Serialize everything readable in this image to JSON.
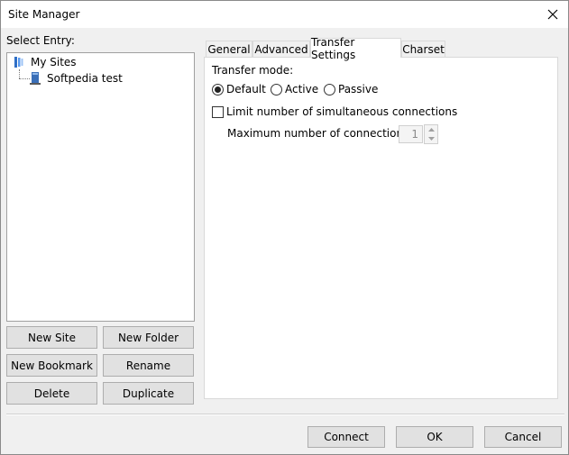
{
  "window": {
    "title": "Site Manager"
  },
  "left": {
    "select_entry_label": "Select Entry:",
    "tree": [
      {
        "label": "My Sites",
        "icon": "folder-icon"
      },
      {
        "label": "Softpedia test",
        "icon": "server-icon"
      }
    ],
    "buttons": {
      "new_site": "New Site",
      "new_folder": "New Folder",
      "new_bookmark": "New Bookmark",
      "rename": "Rename",
      "delete": "Delete",
      "duplicate": "Duplicate"
    }
  },
  "tabs": [
    {
      "label": "General"
    },
    {
      "label": "Advanced"
    },
    {
      "label": "Transfer Settings"
    },
    {
      "label": "Charset"
    }
  ],
  "active_tab": "Transfer Settings",
  "transfer": {
    "mode_label": "Transfer mode:",
    "modes": [
      "Default",
      "Active",
      "Passive"
    ],
    "selected_mode": "Default",
    "limit_label": "Limit number of simultaneous connections",
    "limit_checked": false,
    "max_label": "Maximum number of connections:",
    "max_value": "1"
  },
  "footer": {
    "connect": "Connect",
    "ok": "OK",
    "cancel": "Cancel"
  }
}
